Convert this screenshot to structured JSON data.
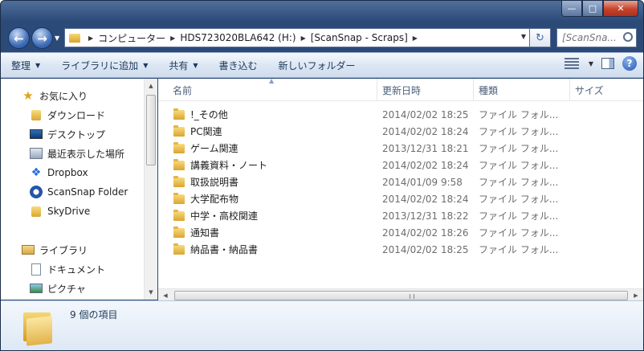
{
  "address": {
    "crumbs": [
      "コンピューター",
      "HDS723020BLA642 (H:)",
      "[ScanSnap - Scraps]"
    ]
  },
  "search": {
    "placeholder": "[ScanSna..."
  },
  "toolbar": {
    "organize": "整理",
    "add_to_library": "ライブラリに追加",
    "share": "共有",
    "burn": "書き込む",
    "new_folder": "新しいフォルダー"
  },
  "nav": {
    "favorites": "お気に入り",
    "downloads": "ダウンロード",
    "desktop": "デスクトップ",
    "recent": "最近表示した場所",
    "dropbox": "Dropbox",
    "scansnap": "ScanSnap Folder",
    "skydrive": "SkyDrive",
    "libraries": "ライブラリ",
    "documents": "ドキュメント",
    "pictures": "ピクチャ"
  },
  "columns": {
    "name": "名前",
    "date": "更新日時",
    "type": "種類",
    "size": "サイズ"
  },
  "files": [
    {
      "name": "!_その他",
      "date": "2014/02/02 18:25",
      "type": "ファイル フォル..."
    },
    {
      "name": "PC関連",
      "date": "2014/02/02 18:24",
      "type": "ファイル フォル..."
    },
    {
      "name": "ゲーム関連",
      "date": "2013/12/31 18:21",
      "type": "ファイル フォル..."
    },
    {
      "name": "講義資料・ノート",
      "date": "2014/02/02 18:24",
      "type": "ファイル フォル..."
    },
    {
      "name": "取扱説明書",
      "date": "2014/01/09 9:58",
      "type": "ファイル フォル..."
    },
    {
      "name": "大学配布物",
      "date": "2014/02/02 18:24",
      "type": "ファイル フォル..."
    },
    {
      "name": "中学・高校関連",
      "date": "2013/12/31 18:22",
      "type": "ファイル フォル..."
    },
    {
      "name": "通知書",
      "date": "2014/02/02 18:26",
      "type": "ファイル フォル..."
    },
    {
      "name": "納品書・納品書",
      "date": "2014/02/02 18:25",
      "type": "ファイル フォル..."
    }
  ],
  "details": {
    "count": "9 個の項目"
  }
}
